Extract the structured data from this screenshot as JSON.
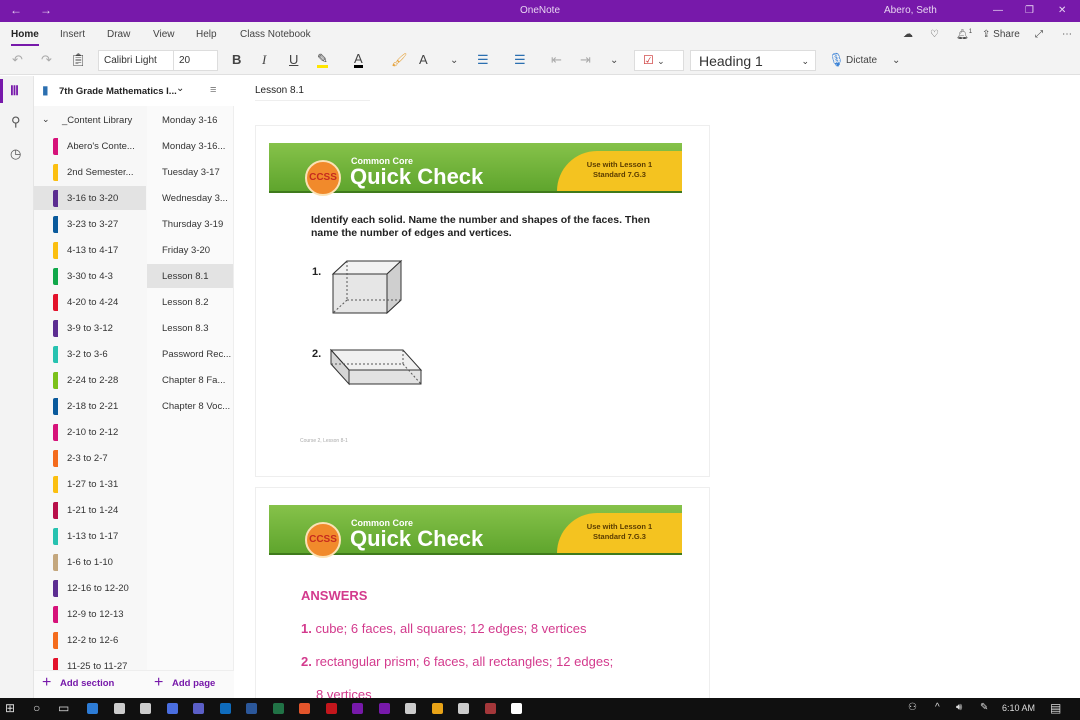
{
  "window": {
    "title": "OneNote",
    "user": "Abero, Seth",
    "back": "←",
    "forward": "→",
    "min": "—",
    "restore": "❐",
    "close": "✕"
  },
  "ribbon": {
    "tabs": [
      "Home",
      "Insert",
      "Draw",
      "View",
      "Help",
      "Class Notebook"
    ],
    "active": "Home",
    "font": "Calibri Light",
    "size": "20",
    "style": "Heading 1",
    "dictate": "Dictate",
    "share": "Share",
    "notif_count": "1"
  },
  "notebook": {
    "name": "7th Grade Mathematics I...",
    "group": "_Content Library"
  },
  "sections": [
    {
      "label": "Abero's Conte...",
      "color": "#d6127a"
    },
    {
      "label": "2nd Semester...",
      "color": "#fbbf10"
    },
    {
      "label": "3-16 to 3-20",
      "color": "#5c2d91",
      "selected": true
    },
    {
      "label": "3-23 to 3-27",
      "color": "#0a5a9c"
    },
    {
      "label": "4-13 to 4-17",
      "color": "#fbbf10"
    },
    {
      "label": "3-30 to 4-3",
      "color": "#10a84a"
    },
    {
      "label": "4-20 to 4-24",
      "color": "#e3122b"
    },
    {
      "label": "3-9 to 3-12",
      "color": "#5c2d91"
    },
    {
      "label": "3-2 to 3-6",
      "color": "#27c2b0"
    },
    {
      "label": "2-24 to 2-28",
      "color": "#7bc11a"
    },
    {
      "label": "2-18 to 2-21",
      "color": "#0a5a9c"
    },
    {
      "label": "2-10 to 2-12",
      "color": "#d6127a"
    },
    {
      "label": "2-3 to 2-7",
      "color": "#f46b1c"
    },
    {
      "label": "1-27 to 1-31",
      "color": "#fbbf10"
    },
    {
      "label": "1-21 to 1-24",
      "color": "#b80f4a"
    },
    {
      "label": "1-13 to 1-17",
      "color": "#27c2b0"
    },
    {
      "label": "1-6 to 1-10",
      "color": "#c4a77d"
    },
    {
      "label": "12-16 to 12-20",
      "color": "#5c2d91"
    },
    {
      "label": "12-9 to 12-13",
      "color": "#d6127a"
    },
    {
      "label": "12-2 to 12-6",
      "color": "#f46b1c"
    },
    {
      "label": "11-25 to 11-27",
      "color": "#e3122b"
    }
  ],
  "pages": [
    "Monday 3-16",
    "Monday 3-16...",
    "Tuesday 3-17",
    "Wednesday 3...",
    "Thursday 3-19",
    "Friday 3-20",
    "Lesson 8.1",
    "Lesson 8.2",
    "Lesson 8.3",
    "Password Rec...",
    "Chapter 8 Fa...",
    "Chapter 8 Voc..."
  ],
  "selected_page": "Lesson 8.1",
  "add_section": "Add section",
  "add_page": "Add page",
  "page": {
    "title": "Lesson 8.1",
    "banner": {
      "badge": "CCSS",
      "subtitle": "Common Core",
      "title": "Quick Check",
      "lesson": "Use with Lesson 1",
      "standard": "Standard 7.G.3"
    },
    "instructions": "Identify each solid. Name the number and shapes of the faces. Then name the number of edges and vertices.",
    "items": [
      "1.",
      "2."
    ],
    "footer": "Course 2, Lesson 8-1",
    "answers_heading": "ANSWERS",
    "answers": [
      {
        "num": "1.",
        "text": "cube; 6 faces, all squares; 12 edges; 8 vertices"
      },
      {
        "num": "2.",
        "text": "rectangular prism; 6 faces, all rectangles; 12 edges;"
      }
    ],
    "answers_cont": "8 vertices"
  },
  "taskbar": {
    "time": "6:10 AM"
  },
  "colors": {
    "accent": "#7719aa",
    "answers": "#d33a8d"
  }
}
